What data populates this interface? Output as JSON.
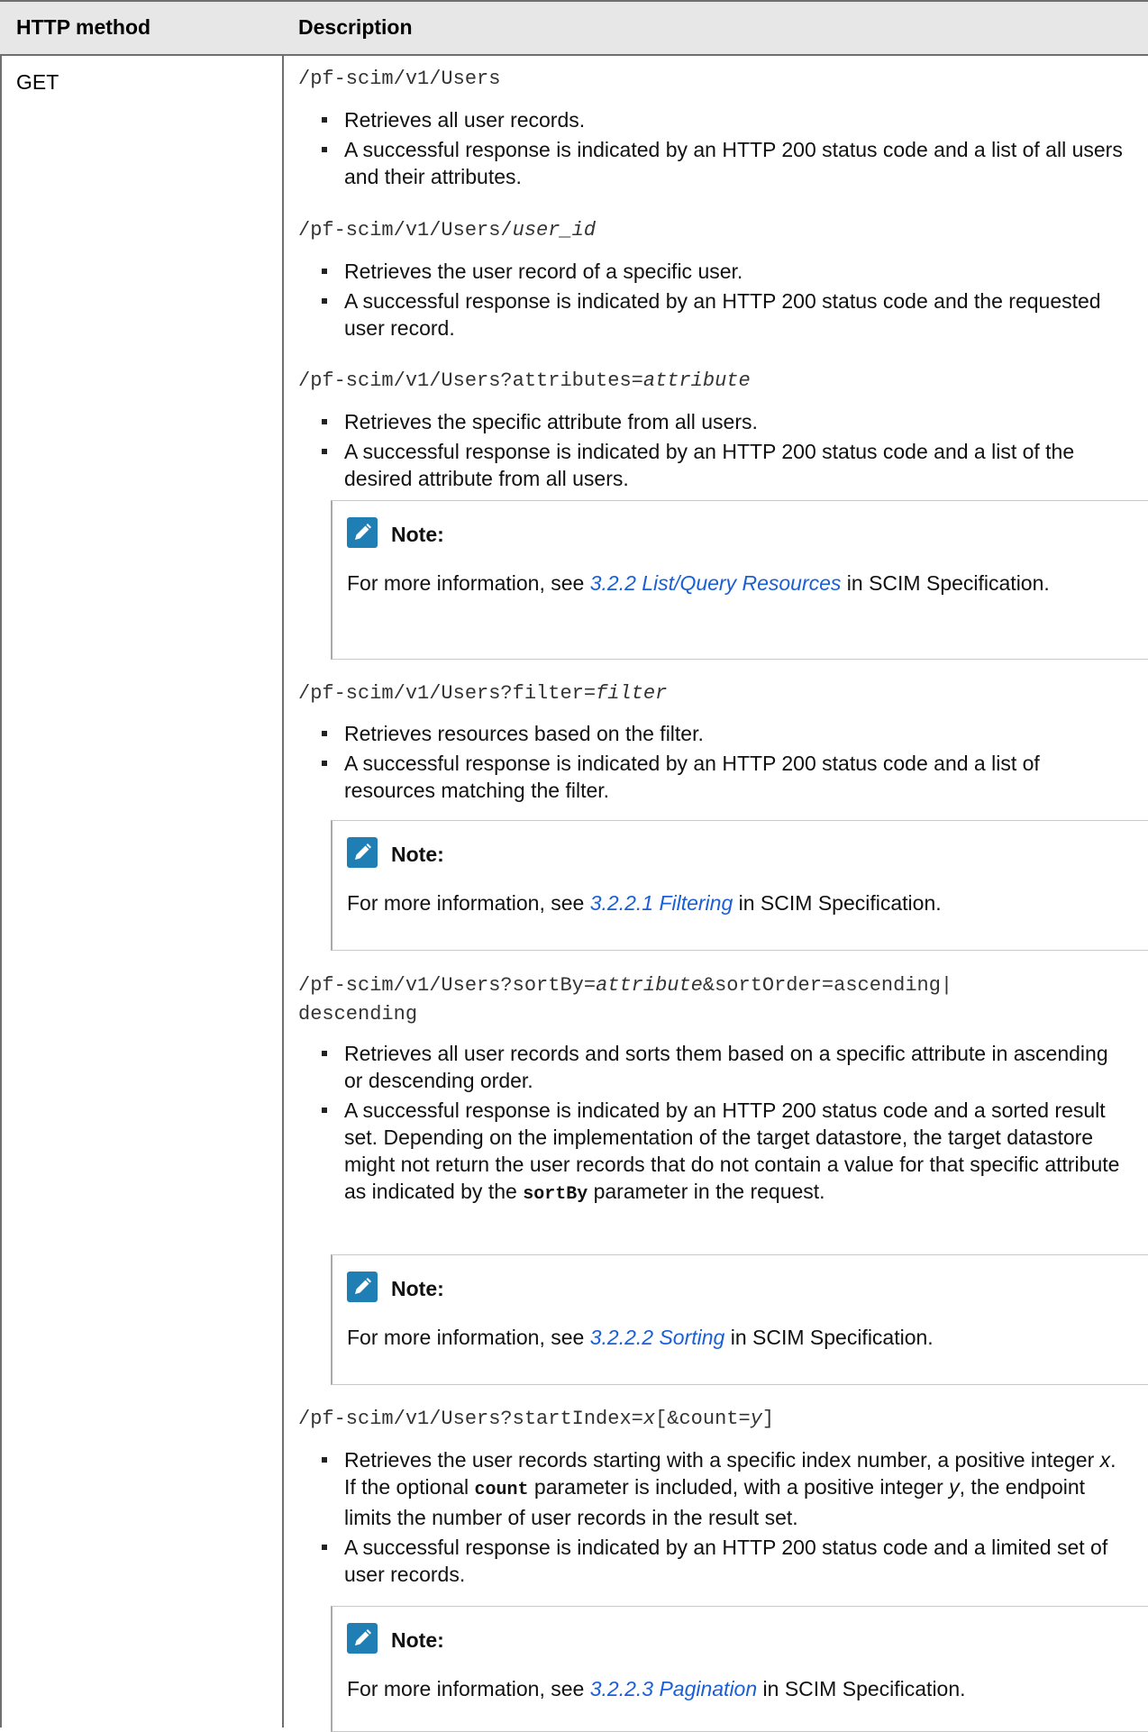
{
  "table": {
    "headers": {
      "method": "HTTP method",
      "description": "Description"
    },
    "method": "GET",
    "sections": [
      {
        "path_prefix": "/pf-scim/v1/Users",
        "path_var": "",
        "path_suffix": "",
        "bullets": [
          "Retrieves all user records.",
          "A successful response is indicated by an HTTP 200 status code and a list of all users and their attributes."
        ]
      },
      {
        "path_prefix": "/pf-scim/v1/Users/",
        "path_var": "user_id",
        "path_suffix": "",
        "bullets": [
          "Retrieves the user record of a specific user.",
          "A successful response is indicated by an HTTP 200 status code and the requested user record."
        ]
      },
      {
        "path_prefix": "/pf-scim/v1/Users?attributes=",
        "path_var": "attribute",
        "path_suffix": "",
        "bullets": [
          "Retrieves the specific attribute from all users.",
          "A successful response is indicated by an HTTP 200 status code and a list of the desired attribute from all users."
        ],
        "note": {
          "title": "Note:",
          "before": "For more information, see ",
          "link": "3.2.2 List/Query Resources",
          "after": " in SCIM Specification."
        }
      },
      {
        "path_prefix": "/pf-scim/v1/Users?filter=",
        "path_var": "filter",
        "path_suffix": "",
        "bullets": [
          "Retrieves resources based on the filter.",
          "A successful response is indicated by an HTTP 200 status code and a list of resources matching the filter."
        ],
        "note": {
          "title": "Note:",
          "before": "For more information, see ",
          "link": "3.2.2.1 Filtering",
          "after": " in SCIM Specification."
        }
      },
      {
        "path_prefix": "/pf-scim/v1/Users?sortBy=",
        "path_var": "attribute",
        "path_suffix": "&sortOrder=ascending|",
        "path_line2": "descending",
        "bullets": [
          "Retrieves all user records and sorts them based on a specific attribute in ascending or descending order."
        ],
        "bullet_sort_a": "A successful response is indicated by an HTTP 200 status code and a sorted result set. Depending on the implementation of the target datastore, the target datastore might not return the user records that do not contain a value for that specific attribute as indicated by the ",
        "bullet_sort_code": "sortBy",
        "bullet_sort_b": " parameter in the request.",
        "note": {
          "title": "Note:",
          "before": "For more information, see ",
          "link": "3.2.2.2 Sorting",
          "after": " in SCIM Specification."
        }
      },
      {
        "path_prefix": "/pf-scim/v1/Users?startIndex=",
        "path_var": "x",
        "path_mid": "[&count=",
        "path_var2": "y",
        "path_suffix": "]",
        "bullet_page_a": "Retrieves the user records starting with a specific index number, a positive integer ",
        "bullet_page_x": "x",
        "bullet_page_b": ". If the optional ",
        "bullet_page_code": "count",
        "bullet_page_c": " parameter is included, with a positive integer ",
        "bullet_page_y": "y",
        "bullet_page_d": ", the endpoint limits the number of user records in the result set.",
        "bullets": [
          "A successful response is indicated by an HTTP 200 status code and a limited set of user records."
        ],
        "note": {
          "title": "Note:",
          "before": "For more information, see ",
          "link": "3.2.2.3 Pagination",
          "after": " in SCIM Specification."
        }
      }
    ]
  }
}
